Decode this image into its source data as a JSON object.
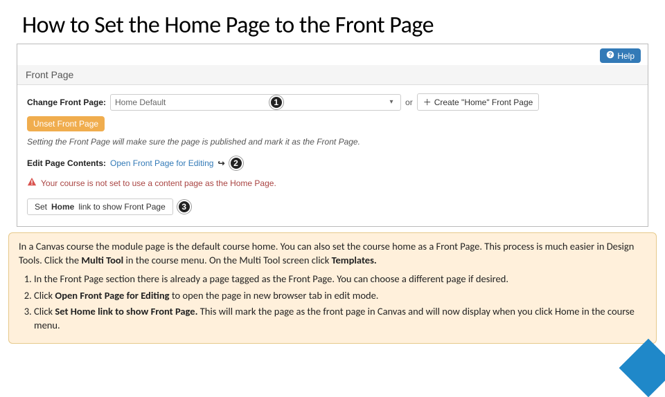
{
  "title": "How to Set the Home Page to the Front Page",
  "help": {
    "label": "Help"
  },
  "panel": {
    "heading": "Front Page"
  },
  "changeRow": {
    "label": "Change Front Page:",
    "selectValue": "Home Default",
    "or": "or",
    "createLabel": "Create \"Home\" Front Page",
    "badge": "1"
  },
  "unset": {
    "label": "Unset Front Page"
  },
  "infoItalic": "Setting the Front Page will make sure the page is published and mark it as the Front Page.",
  "editRow": {
    "label": "Edit Page Contents:",
    "linkText": "Open Front Page for Editing",
    "badge": "2"
  },
  "warning": "Your course is not set to use a content page as the Home Page.",
  "setHome": {
    "prefix": "Set ",
    "boldWord": "Home",
    "suffix": " link to show Front Page",
    "badge": "3"
  },
  "callout": {
    "intro_a": "In a Canvas course the module page is the default course home. You can also set the course home as a Front Page. This process is much easier in Design Tools. Click the ",
    "intro_bold1": "Multi Tool",
    "intro_b": " in the course menu. On the Multi Tool screen click ",
    "intro_bold2": "Templates.",
    "items": [
      {
        "a": "In the Front Page section there is already a page tagged as the Front Page. You can choose a different page if desired."
      },
      {
        "a": "Click ",
        "b": "Open Front Page for Editing",
        "c": " to open the page in new browser tab in edit mode."
      },
      {
        "a": "Click ",
        "b": "Set Home link to show Front Page.",
        "c": " This will mark the page as the front page in Canvas and will now display when you click Home in the course menu."
      }
    ]
  }
}
